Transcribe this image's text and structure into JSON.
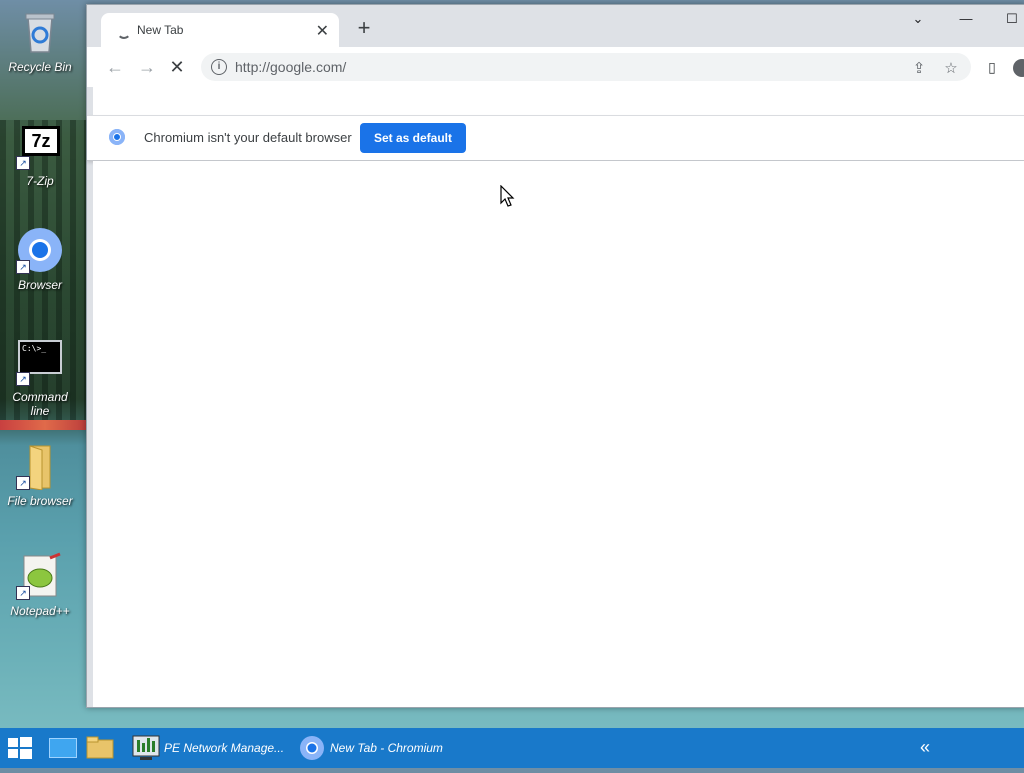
{
  "desktop": {
    "icons": [
      {
        "label": "Recycle Bin",
        "icon": "recycle-bin-icon"
      },
      {
        "label": "7-Zip",
        "icon": "seven-zip-icon",
        "glyph": "7z"
      },
      {
        "label": "Browser",
        "icon": "chromium-icon"
      },
      {
        "label": "Command line",
        "icon": "command-prompt-icon",
        "glyph": "C:\\>_"
      },
      {
        "label": "File browser",
        "icon": "folder-icon"
      },
      {
        "label": "Notepad++",
        "icon": "notepad-plus-plus-icon"
      }
    ]
  },
  "browser": {
    "tab": {
      "title": "New Tab",
      "close": "✕"
    },
    "new_tab": "+",
    "window_controls": {
      "tab_search": "⌄",
      "minimize": "—",
      "maximize": "☐"
    },
    "toolbar": {
      "back": "←",
      "forward": "→",
      "stop": "✕",
      "url": "http://google.com/",
      "info": "i",
      "share": "⇪",
      "bookmark": "☆",
      "side_panel": "▯"
    },
    "infobar": {
      "message": "Chromium isn't your default browser",
      "button_label": "Set as default"
    }
  },
  "taskbar": {
    "items": [
      {
        "label": "PE Network Manage...",
        "icon": "network-manager-icon"
      },
      {
        "label": "New Tab - Chromium",
        "icon": "chromium-icon"
      }
    ],
    "overflow": "«"
  },
  "colors": {
    "accent": "#1a73e8",
    "taskbar": "#1979ca",
    "tabstrip": "#dee1e6"
  }
}
